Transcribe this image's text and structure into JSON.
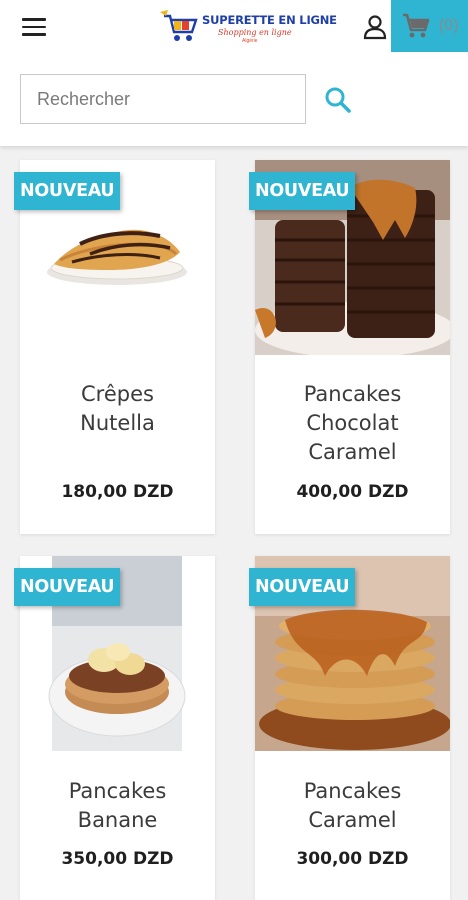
{
  "header": {
    "logo": {
      "title": "SUPERETTE EN LIGNE",
      "subtitle": "Shopping en ligne",
      "tagline": "Algérie"
    },
    "icons": {
      "menu": "hamburger-icon",
      "user": "user-icon",
      "cart": "cart-icon",
      "search": "search-icon"
    },
    "cart_count": "(0)"
  },
  "search": {
    "placeholder": "Rechercher",
    "value": ""
  },
  "colors": {
    "accent": "#2fb5d2",
    "header_bg": "#ffffff",
    "page_bg": "#f1f1f1"
  },
  "products": [
    {
      "name": "Crêpes Nutella",
      "price": "180,00 DZD",
      "badge": "NOUVEAU"
    },
    {
      "name": "Pancakes Chocolat Caramel",
      "price": "400,00 DZD",
      "badge": "NOUVEAU"
    },
    {
      "name": "Pancakes Banane",
      "price": "350,00 DZD",
      "badge": "NOUVEAU"
    },
    {
      "name": "Pancakes Caramel",
      "price": "300,00 DZD",
      "badge": "NOUVEAU"
    }
  ]
}
